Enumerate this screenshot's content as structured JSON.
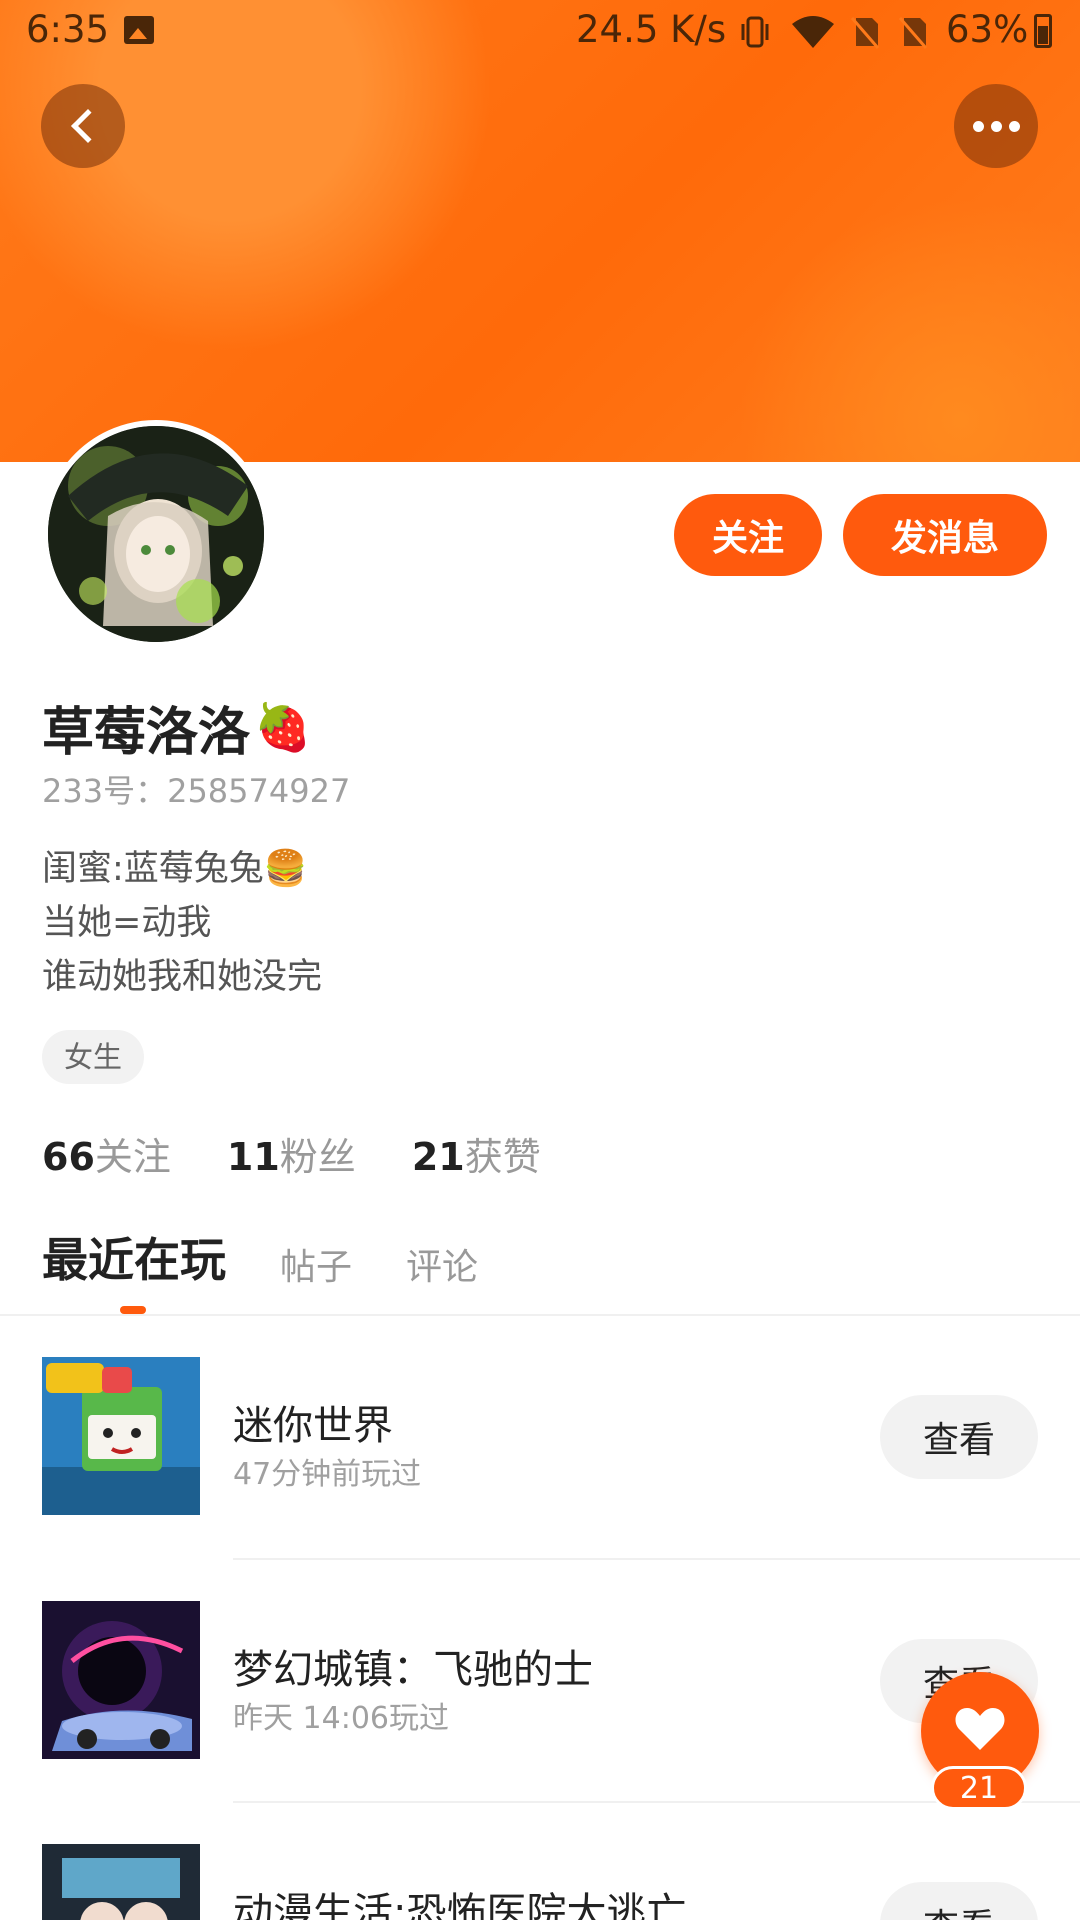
{
  "status_bar": {
    "time": "6:35",
    "net_speed": "24.5 K/s",
    "battery": "63%",
    "icons": [
      "image-icon",
      "vibrate-icon",
      "wifi-icon",
      "no-sim-icon",
      "no-sim-icon",
      "battery-icon"
    ]
  },
  "header": {
    "back_icon": "back-icon",
    "more_icon": "more-icon",
    "accent_color": "#ff6a0a"
  },
  "profile": {
    "follow_label": "关注",
    "message_label": "发消息",
    "name": "草莓洛洛",
    "name_emoji": "🍓",
    "id_line": "233号：258574927",
    "bio_lines": [
      "闺蜜:蓝莓兔兔🍔",
      "当她=动我",
      "谁动她我和她没完"
    ],
    "tag": "女生"
  },
  "stats": [
    {
      "num": "66",
      "label": "关注"
    },
    {
      "num": "11",
      "label": "粉丝"
    },
    {
      "num": "21",
      "label": "获赞"
    }
  ],
  "tabs": [
    {
      "label": "最近在玩",
      "active": true
    },
    {
      "label": "帖子",
      "active": false
    },
    {
      "label": "评论",
      "active": false
    }
  ],
  "games": [
    {
      "name": "迷你世界",
      "time": "47分钟前玩过",
      "button": "查看"
    },
    {
      "name": "梦幻城镇：飞驰的士",
      "time": "昨天 14:06玩过",
      "button": "查看"
    },
    {
      "name": "动漫生活:恐怖医院大逃亡",
      "time": "",
      "button": "查看"
    }
  ],
  "like_fab": {
    "icon": "heart-icon",
    "count": "21"
  }
}
